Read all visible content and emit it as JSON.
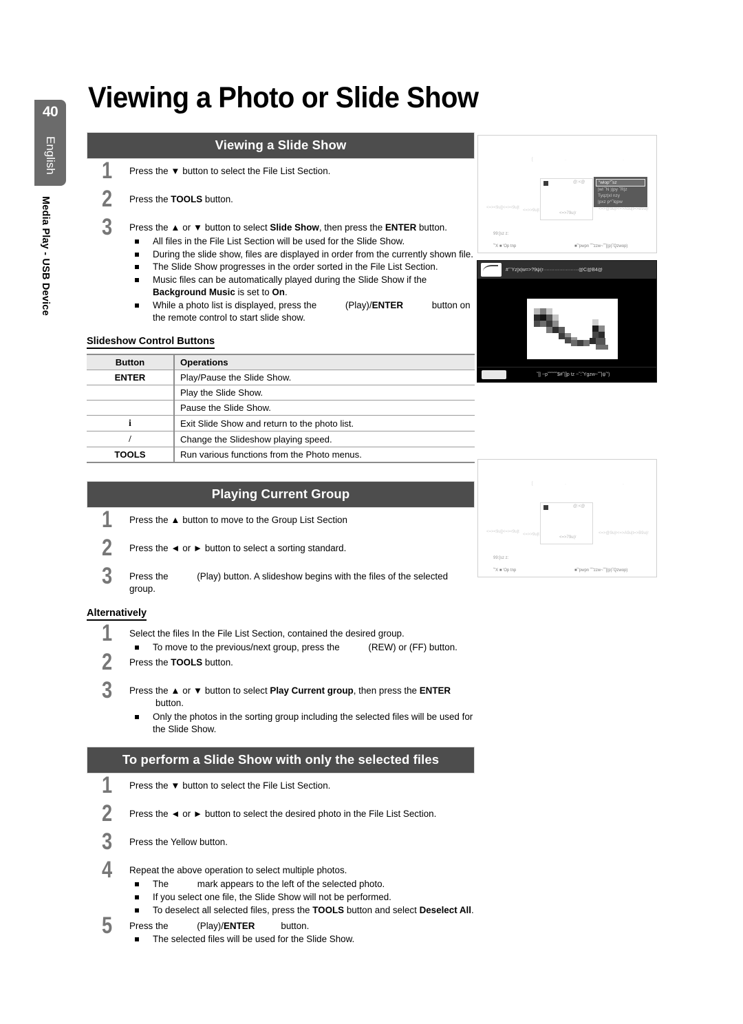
{
  "page": {
    "number": "40",
    "language": "English",
    "chapter": "Media Play - USB Device",
    "title": "Viewing a Photo or Slide Show"
  },
  "sections": {
    "viewing_slide_show": {
      "heading": "Viewing a Slide Show",
      "steps": [
        {
          "num": "1",
          "text_pre": "Press the ",
          "arrow": "▼",
          "text_post": " button to select the File List Section."
        },
        {
          "num": "2",
          "text": "Press the TOOLS button."
        },
        {
          "num": "3",
          "text": "Press the ▲ or ▼ button to select Slide Show, then press the ENTER button."
        }
      ],
      "step3_bullets": [
        "All files in the File List Section will be used for the Slide Show.",
        "During the slide show, files are displayed in order from the currently shown file.",
        "The Slide Show progresses in the order sorted in the File List Section.",
        "Music files can be automatically played during the Slide Show if the Background Music is set to On.",
        "While a photo list is displayed, press the (Play)/ENTER button on the remote control to start slide show."
      ]
    },
    "control_buttons": {
      "heading": "Slideshow Control Buttons",
      "columns": [
        "Button",
        "Operations"
      ],
      "rows": [
        {
          "button": "ENTER",
          "operation": "Play/Pause the Slide Show."
        },
        {
          "button": "",
          "operation": "Play the Slide Show."
        },
        {
          "button": "",
          "operation": "Pause the Slide Show."
        },
        {
          "button": "i",
          "operation": "Exit Slide Show and return to the photo list."
        },
        {
          "button": "/",
          "operation": "Change the Slideshow playing speed."
        },
        {
          "button": "TOOLS",
          "operation": "Run various functions from the Photo menus."
        }
      ]
    },
    "playing_current_group": {
      "heading": "Playing Current Group",
      "steps": [
        "Press the ▲ button to move to the Group List Section",
        "Press the ◄ or ► button to select a sorting standard.",
        "Press the (Play) button. A slideshow begins with the files of the selected group."
      ]
    },
    "alternatively": {
      "heading": "Alternatively",
      "step1": "Select the files In the File List Section, contained the desired group.",
      "step1_bullet": "To move to the previous/next group, press the (REW) or (FF) button.",
      "step2": "Press the TOOLS button.",
      "step3": "Press the ▲ or ▼ button to select Play Current group, then press the ENTER button.",
      "step3_bullet": "Only the photos in the sorting group including the selected files will be used for the Slide Show."
    },
    "selected_files": {
      "heading": "To perform a Slide Show with only the selected files",
      "steps": [
        "Press the ▼ button to select the File List Section.",
        "Press the ◄ or ► button to select the desired photo in the File List Section.",
        "Press the Yellow button.",
        "Repeat the above operation to select multiple photos.",
        "Press the (Play)/ENTER button."
      ],
      "step4_bullets": [
        "The mark appears to the left of the selected photo.",
        "If you select one file, the Slide Show will not be performed.",
        "To deselect all selected files, press the TOOLS button and select Deselect All."
      ],
      "step5_bullet": "The selected files will be used for the Slide Show."
    }
  },
  "screenshots": {
    "tv_menu_top": {
      "label": "TV photo list with Tools menu open",
      "menu_items": [
        "\"wlop\"˜sz",
        "|wl ˜N )|py ˜R|z",
        "Tyqz|xl nzy",
        "|pxz p^˜lqpw"
      ],
      "bottom_left": "99:[sz z:",
      "bottom_nav_left": "˜'X  ■ 'Op tnp",
      "bottom_nav_right": "■˜'pwpn ˜˜'zzw~˜˜[(p)˜Qzwop)",
      "panel_corner": "@:<@",
      "panel_text": "<=>79u(r"
    },
    "photo_viewer": {
      "label": "Slide show photo viewer",
      "topbar_text": "#˜˜Yz]x|w=>?9ψ(r······················@C@B4@",
      "bottombar_text": "˜[| ~p˜˜˜˜˜˜$#˜|]p tz ~˜:˜Ygzw~˜˜|ψ˜')"
    },
    "tv_menu_bottom": {
      "label": "TV photo list group view",
      "bottom_left": "99:[sz z:",
      "bottom_nav_left": "˜'X  ■ 'Op tnp",
      "bottom_nav_right": "■˜'pwpn ˜˜'zzw~˜˜[(p)˜Qzwop)",
      "panel_corner": "@:<@",
      "panel_text": "<=>79u(r"
    }
  },
  "colors": {
    "bar": "#4d4d4d",
    "tab": "#6b6b6b",
    "step_number": "#777777",
    "table_header": "#e9e9e9"
  }
}
